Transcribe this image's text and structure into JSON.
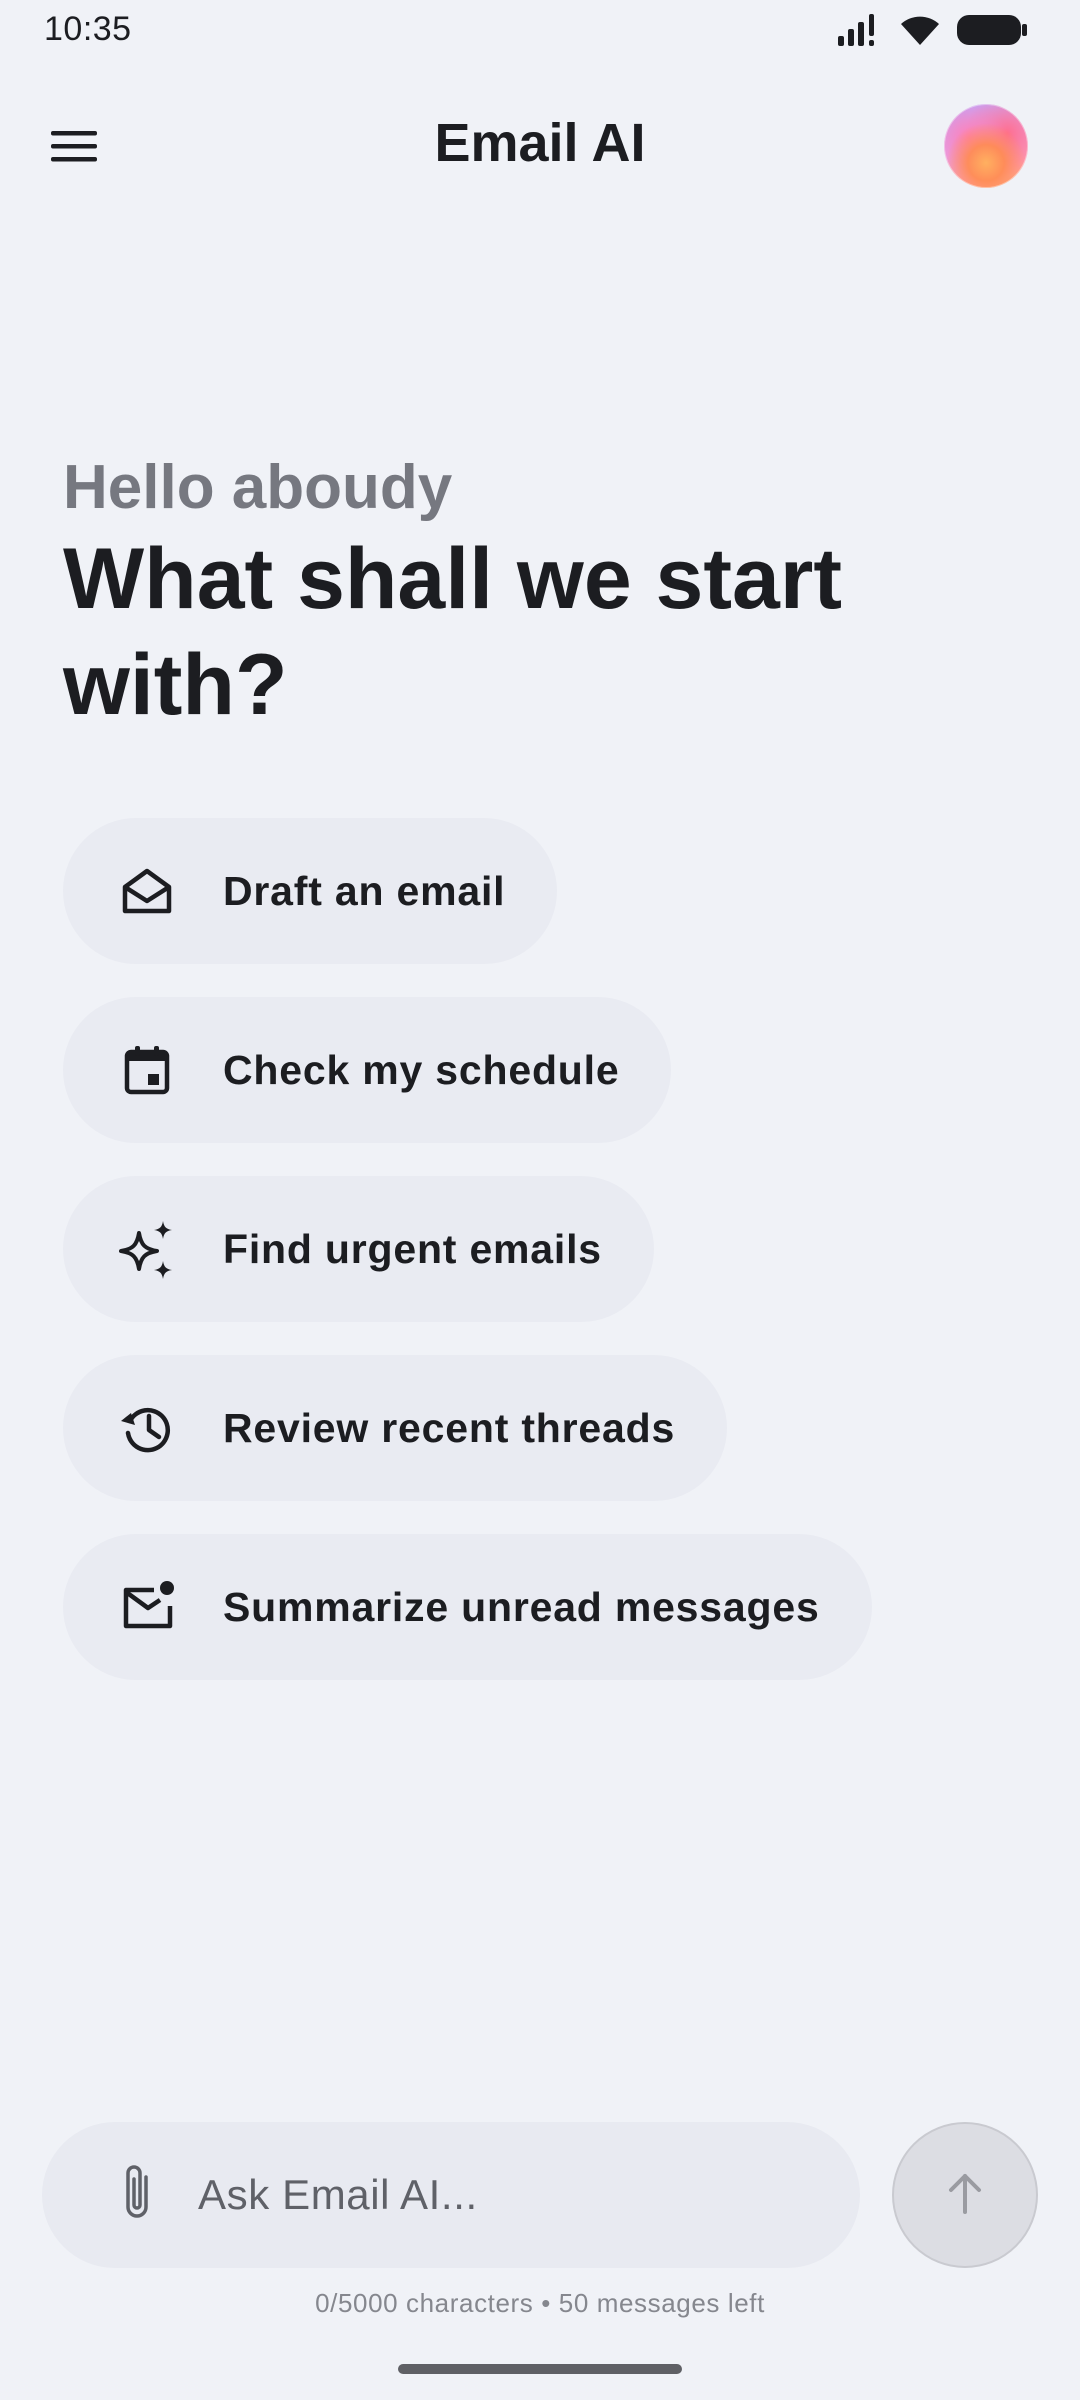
{
  "status_bar": {
    "time": "10:35",
    "icons": [
      "signal-icon",
      "wifi-icon",
      "battery-icon"
    ]
  },
  "app_bar": {
    "title": "Email AI",
    "menu_icon": "menu-icon",
    "avatar": "avatar"
  },
  "greeting": {
    "hello": "Hello aboudy",
    "headline": "What shall we start with?"
  },
  "suggestions": [
    {
      "label": "Draft an email",
      "icon": "envelope-open-icon"
    },
    {
      "label": "Check my schedule",
      "icon": "calendar-icon"
    },
    {
      "label": "Find urgent emails",
      "icon": "sparkle-icon"
    },
    {
      "label": "Review recent threads",
      "icon": "history-icon"
    },
    {
      "label": "Summarize unread messages",
      "icon": "mail-unread-icon"
    }
  ],
  "composer": {
    "placeholder": "Ask Email AI...",
    "attach_icon": "paperclip-icon",
    "send_icon": "arrow-up-icon",
    "counter": "0/5000 characters • 50 messages left"
  },
  "colors": {
    "background": "#f0f2f7",
    "chip": "#e9ebf2",
    "text": "#1c1d21",
    "muted": "#767880"
  }
}
